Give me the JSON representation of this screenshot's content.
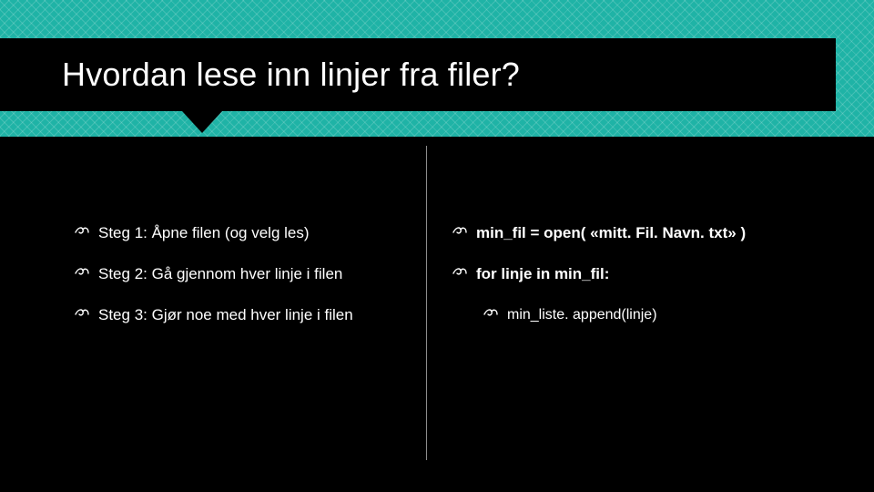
{
  "title": "Hvordan lese inn linjer fra filer?",
  "left": {
    "items": [
      {
        "text": "Steg 1: Åpne filen (og velg les)"
      },
      {
        "text": "Steg 2: Gå gjennom hver linje i filen"
      },
      {
        "text": "Steg 3: Gjør noe med hver linje i filen"
      }
    ]
  },
  "right": {
    "items": [
      {
        "text": "min_fil = open( «mitt. Fil. Navn. txt» )",
        "bold": true
      },
      {
        "text": "for linje in min_fil:",
        "bold": true
      },
      {
        "text": "min_liste. append(linje)",
        "bold": false,
        "sub": true
      }
    ]
  }
}
